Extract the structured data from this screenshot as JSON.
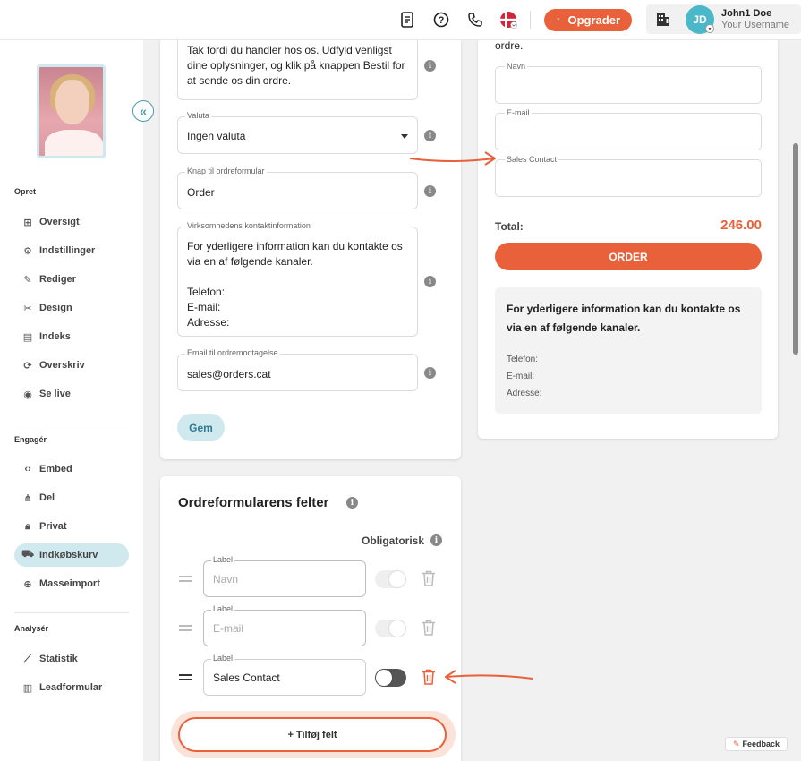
{
  "topbar": {
    "upgrade_label": "Opgrader",
    "user_name": "John1 Doe",
    "user_sub": "Your Username",
    "avatar_initials": "JD"
  },
  "sidebar": {
    "sections": [
      {
        "title": "Opret",
        "items": [
          {
            "label": "Oversigt",
            "icon": "grid-icon"
          },
          {
            "label": "Indstillinger",
            "icon": "gear-icon"
          },
          {
            "label": "Rediger",
            "icon": "pencil-icon"
          },
          {
            "label": "Design",
            "icon": "design-icon"
          },
          {
            "label": "Indeks",
            "icon": "index-icon"
          },
          {
            "label": "Overskriv",
            "icon": "refresh-icon"
          },
          {
            "label": "Se live",
            "icon": "eye-icon"
          }
        ]
      },
      {
        "title": "Engagér",
        "items": [
          {
            "label": "Embed",
            "icon": "code-icon"
          },
          {
            "label": "Del",
            "icon": "share-icon"
          },
          {
            "label": "Privat",
            "icon": "lock-icon"
          },
          {
            "label": "Indkøbskurv",
            "icon": "cart-icon",
            "active": true
          },
          {
            "label": "Masseimport",
            "icon": "import-icon"
          }
        ]
      },
      {
        "title": "Analysér",
        "items": [
          {
            "label": "Statistik",
            "icon": "chart-icon"
          },
          {
            "label": "Leadformular",
            "icon": "form-icon"
          }
        ]
      }
    ]
  },
  "settings": {
    "thanks_text": "Tak fordi du handler hos os. Udfyld venligst\ndine oplysninger, og klik på knappen Bestil for\nat sende os din ordre.",
    "currency_label": "Valuta",
    "currency_value": "Ingen valuta",
    "button_label": "Knap til ordreformular",
    "button_value": "Order",
    "contact_label": "Virksomhedens kontaktinformation",
    "contact_value": "For yderligere information kan du kontakte os\nvia en af følgende kanaler.\n\nTelefon:\nE-mail:\nAdresse:",
    "email_label": "Email til ordremodtagelse",
    "email_value": "sales@orders.cat",
    "save_label": "Gem"
  },
  "fields_card": {
    "title": "Ordreformularens felter",
    "required_label": "Obligatorisk",
    "rows": [
      {
        "legend": "Label",
        "value": "Navn",
        "filled": false
      },
      {
        "legend": "Label",
        "value": "E-mail",
        "filled": false
      },
      {
        "legend": "Label",
        "value": "Sales Contact",
        "filled": true
      }
    ],
    "add_label": "+ Tilføj felt"
  },
  "preview": {
    "top_text": "ordre.",
    "fields": [
      "Navn",
      "E-mail",
      "Sales Contact"
    ],
    "total_label": "Total:",
    "total_value": "246.00",
    "order_label": "ORDER",
    "contact_text": "For yderligere information kan du kontakte os via en af følgende kanaler.",
    "contact_lines": [
      "Telefon:",
      "E-mail:",
      "Adresse:"
    ]
  },
  "feedback_label": "Feedback",
  "colors": {
    "accent": "#e8613a",
    "teal": "#4bb8c9",
    "active_bg": "#cfe9ee"
  }
}
